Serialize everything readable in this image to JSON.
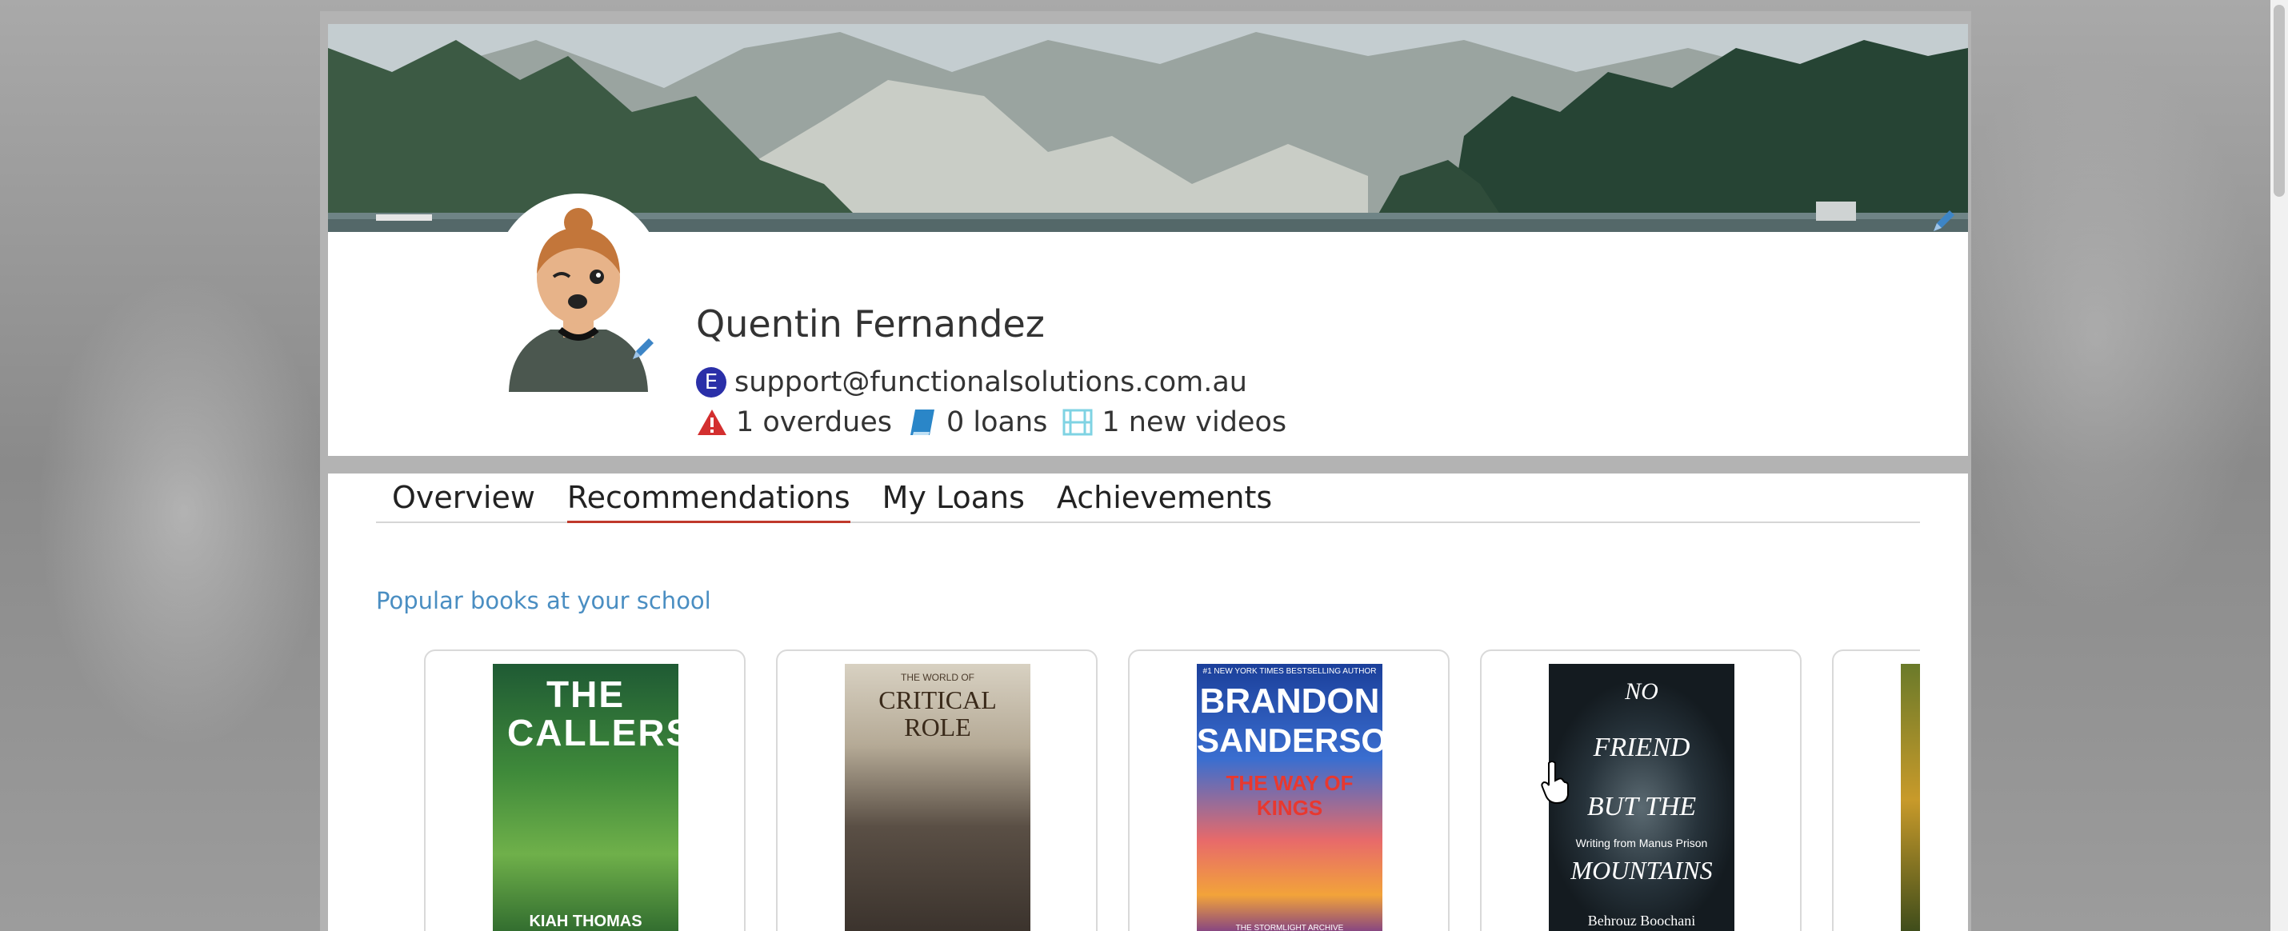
{
  "profile": {
    "name": "Quentin Fernandez",
    "email_badge": "E",
    "email": "support@functionalsolutions.com.au",
    "stats": [
      {
        "icon": "warning-icon",
        "label": "1 overdues"
      },
      {
        "icon": "book-icon",
        "label": "0 loans"
      },
      {
        "icon": "film-icon",
        "label": "1 new videos"
      }
    ]
  },
  "tabs": [
    {
      "label": "Overview",
      "active": false
    },
    {
      "label": "Recommendations",
      "active": true
    },
    {
      "label": "My Loans",
      "active": false
    },
    {
      "label": "Achievements",
      "active": false
    }
  ],
  "section": {
    "heading": "Popular books at your school"
  },
  "books": [
    {
      "cover_title": "THE CALLERS",
      "cover_author": "KIAH THOMAS"
    },
    {
      "cover_kicker": "THE WORLD OF",
      "cover_title": "CRITICAL ROLE"
    },
    {
      "cover_kicker": "#1 NEW YORK TIMES BESTSELLING AUTHOR",
      "cover_title_line1": "BRANDON",
      "cover_title_line2": "SANDERSON",
      "cover_subtitle": "THE WAY OF KINGS",
      "cover_footer": "THE STORMLIGHT ARCHIVE"
    },
    {
      "cover_title_line1": "NO",
      "cover_title_line2": "FRIEND",
      "cover_title_line3": "BUT THE",
      "cover_subtitle": "Writing from Manus Prison",
      "cover_title_line4": "MOUNTAINS",
      "cover_author": "Behrouz Boochani"
    }
  ],
  "colors": {
    "accent_tab_underline": "#c0392b",
    "section_heading": "#4a8ec2",
    "email_badge": "#2a2fa8",
    "edit_icon": "#3d85c6"
  }
}
